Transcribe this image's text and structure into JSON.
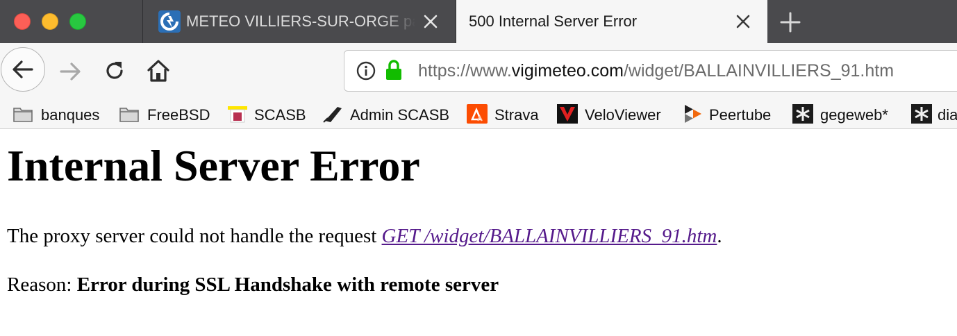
{
  "tabs": [
    {
      "title": "METEO VILLIERS-SUR-ORGE pa",
      "active": false
    },
    {
      "title": "500 Internal Server Error",
      "active": true
    }
  ],
  "urlbar": {
    "protocol": "https://www.",
    "host": "vigimeteo.com",
    "path": "/widget/BALLAINVILLIERS_91.htm"
  },
  "bookmarks": [
    {
      "label": "banques",
      "icon": "folder-icon"
    },
    {
      "label": "FreeBSD",
      "icon": "folder-icon"
    },
    {
      "label": "SCASB",
      "icon": "scasb-icon"
    },
    {
      "label": "Admin SCASB",
      "icon": "admin-scasb-icon"
    },
    {
      "label": "Strava",
      "icon": "strava-icon"
    },
    {
      "label": "VeloViewer",
      "icon": "veloviewer-icon"
    },
    {
      "label": "Peertube",
      "icon": "peertube-icon"
    },
    {
      "label": "gegeweb*",
      "icon": "gegeweb-icon"
    },
    {
      "label": "dia",
      "icon": "gegeweb-icon"
    }
  ],
  "page": {
    "heading": "Internal Server Error",
    "request_prefix": "The proxy server could not handle the request ",
    "request_link": "GET /widget/BALLAINVILLIERS_91.htm",
    "request_suffix": ".",
    "reason_label": "Reason: ",
    "reason_text": "Error during SSL Handshake with remote server"
  },
  "colors": {
    "tabstrip": "#4a4a4d",
    "toolbar": "#f6f6f6",
    "visited_link": "#551a8b",
    "lock": "#12bc00"
  }
}
